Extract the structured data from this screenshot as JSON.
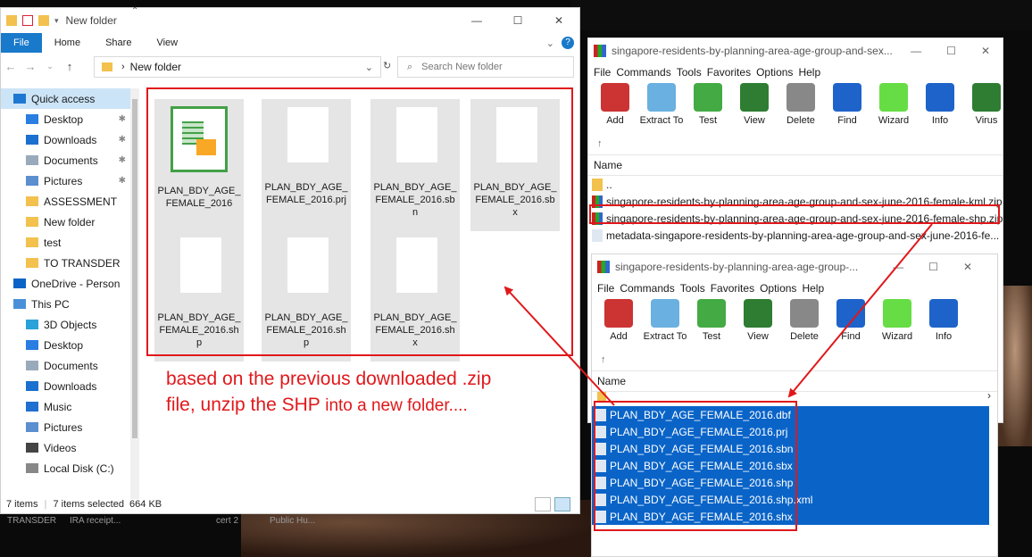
{
  "explorer": {
    "title": "New folder",
    "ribbon_tabs": [
      "File",
      "Home",
      "Share",
      "View"
    ],
    "address_path": "New folder",
    "search_placeholder": "Search New folder",
    "nav": [
      {
        "label": "Quick access",
        "icon": "star-icon"
      },
      {
        "label": "Desktop",
        "icon": "desktop-icon",
        "pinned": true
      },
      {
        "label": "Downloads",
        "icon": "download-icon",
        "pinned": true
      },
      {
        "label": "Documents",
        "icon": "documents-icon",
        "pinned": true
      },
      {
        "label": "Pictures",
        "icon": "pictures-icon",
        "pinned": true
      },
      {
        "label": "ASSESSMENT",
        "icon": "folder-icon"
      },
      {
        "label": "New folder",
        "icon": "folder-icon"
      },
      {
        "label": "test",
        "icon": "folder-icon"
      },
      {
        "label": "TO TRANSDER",
        "icon": "folder-icon"
      },
      {
        "label": "OneDrive - Person",
        "icon": "cloud-icon"
      },
      {
        "label": "This PC",
        "icon": "computer-icon"
      },
      {
        "label": "3D Objects",
        "icon": "cube-icon"
      },
      {
        "label": "Desktop",
        "icon": "desktop-icon"
      },
      {
        "label": "Documents",
        "icon": "documents-icon"
      },
      {
        "label": "Downloads",
        "icon": "download-icon"
      },
      {
        "label": "Music",
        "icon": "music-icon"
      },
      {
        "label": "Pictures",
        "icon": "pictures-icon"
      },
      {
        "label": "Videos",
        "icon": "videos-icon"
      },
      {
        "label": "Local Disk (C:)",
        "icon": "disk-icon"
      }
    ],
    "files": [
      {
        "label": "PLAN_BDY_AGE_\nFEMALE_2016",
        "type": "spreadsheet"
      },
      {
        "label": "PLAN_BDY_AGE_\nFEMALE_2016.prj",
        "type": "blank"
      },
      {
        "label": "PLAN_BDY_AGE_\nFEMALE_2016.sb\nn",
        "type": "blank"
      },
      {
        "label": "PLAN_BDY_AGE_\nFEMALE_2016.sb\nx",
        "type": "blank"
      },
      {
        "label": "PLAN_BDY_AGE_\nFEMALE_2016.sh\np",
        "type": "blank"
      },
      {
        "label": "PLAN_BDY_AGE_\nFEMALE_2016.sh\np",
        "type": "blank"
      },
      {
        "label": "PLAN_BDY_AGE_\nFEMALE_2016.sh\nx",
        "type": "blank"
      }
    ],
    "status_items": "7 items",
    "status_selected": "7 items selected  664 KB"
  },
  "rar1": {
    "title": "singapore-residents-by-planning-area-age-group-and-sex...",
    "menu": [
      "File",
      "Commands",
      "Tools",
      "Favorites",
      "Options",
      "Help"
    ],
    "toolbar": [
      "Add",
      "Extract To",
      "Test",
      "View",
      "Delete",
      "Find",
      "Wizard",
      "Info",
      "Virus"
    ],
    "column_name": "Name",
    "rows": [
      "..",
      "singapore-residents-by-planning-area-age-group-and-sex-june-2016-female-kml.zip",
      "singapore-residents-by-planning-area-age-group-and-sex-june-2016-female-shp.zip",
      "metadata-singapore-residents-by-planning-area-age-group-and-sex-june-2016-fe..."
    ]
  },
  "rar2": {
    "title": "singapore-residents-by-planning-area-age-group-...",
    "menu": [
      "File",
      "Commands",
      "Tools",
      "Favorites",
      "Options",
      "Help"
    ],
    "toolbar": [
      "Add",
      "Extract To",
      "Test",
      "View",
      "Delete",
      "Find",
      "Wizard",
      "Info"
    ],
    "column_name": "Name",
    "rows": [
      "PLAN_BDY_AGE_FEMALE_2016.dbf",
      "PLAN_BDY_AGE_FEMALE_2016.prj",
      "PLAN_BDY_AGE_FEMALE_2016.sbn",
      "PLAN_BDY_AGE_FEMALE_2016.sbx",
      "PLAN_BDY_AGE_FEMALE_2016.shp",
      "PLAN_BDY_AGE_FEMALE_2016.shp.xml",
      "PLAN_BDY_AGE_FEMALE_2016.shx"
    ]
  },
  "annotation": {
    "line1": "based on the previous downloaded .zip",
    "line2_a": "file, unzip the SHP",
    "line2_b": "into a new folder...."
  },
  "taskbar": {
    "items": [
      "TRANSDER",
      "IRA receipt...",
      "cert 2",
      "Public Hu..."
    ]
  },
  "colors": {
    "accent": "#1979ca",
    "annotation": "#e0181b",
    "selection": "#0a64c8"
  }
}
